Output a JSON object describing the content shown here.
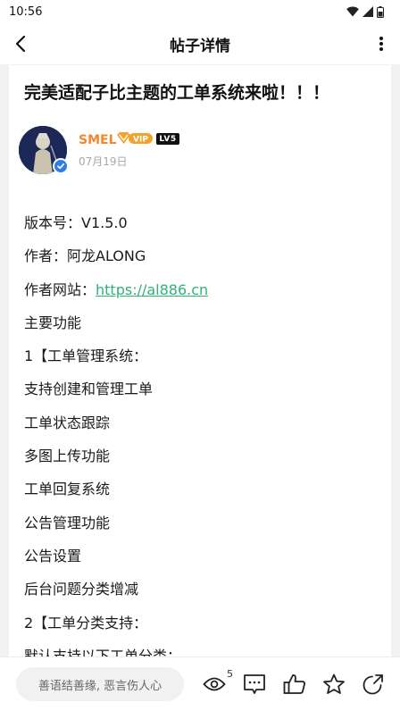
{
  "status_bar": {
    "time": "10:56",
    "icons": [
      "wifi-icon",
      "signal-icon",
      "battery-icon"
    ]
  },
  "header": {
    "title": "帖子详情",
    "back_icon": "chevron-left-icon",
    "more_icon": "more-vertical-icon"
  },
  "post": {
    "title": "完美适配子比主题的工单系统来啦！！！",
    "author": {
      "name": "SMEL",
      "vip_badge": "VIP",
      "level": "LV5",
      "date": "07月19日"
    },
    "lines": [
      {
        "text": "版本号：V1.5.0"
      },
      {
        "text": "作者：阿龙ALONG"
      },
      {
        "text": "作者网站：",
        "link": "https://al886.cn"
      },
      {
        "text": "主要功能"
      },
      {
        "text": "1【工单管理系统："
      },
      {
        "text": "支持创建和管理工单"
      },
      {
        "text": "工单状态跟踪"
      },
      {
        "text": "多图上传功能"
      },
      {
        "text": "工单回复系统"
      },
      {
        "text": "公告管理功能"
      },
      {
        "text": "公告设置"
      },
      {
        "text": "后台问题分类增减"
      },
      {
        "text": "2【工单分类支持："
      },
      {
        "text": "默认支持以下工单分类："
      }
    ]
  },
  "bottom_bar": {
    "comment_placeholder": "善语结善缘, 恶言伤人心",
    "view_count": "5",
    "icons": [
      "eye-icon",
      "comment-icon",
      "like-icon",
      "star-icon",
      "share-icon"
    ]
  },
  "colors": {
    "author_name": "#f0892c",
    "link": "#2fb27a",
    "verified": "#2f7ee8",
    "vip_gold": "#f3a12f"
  }
}
